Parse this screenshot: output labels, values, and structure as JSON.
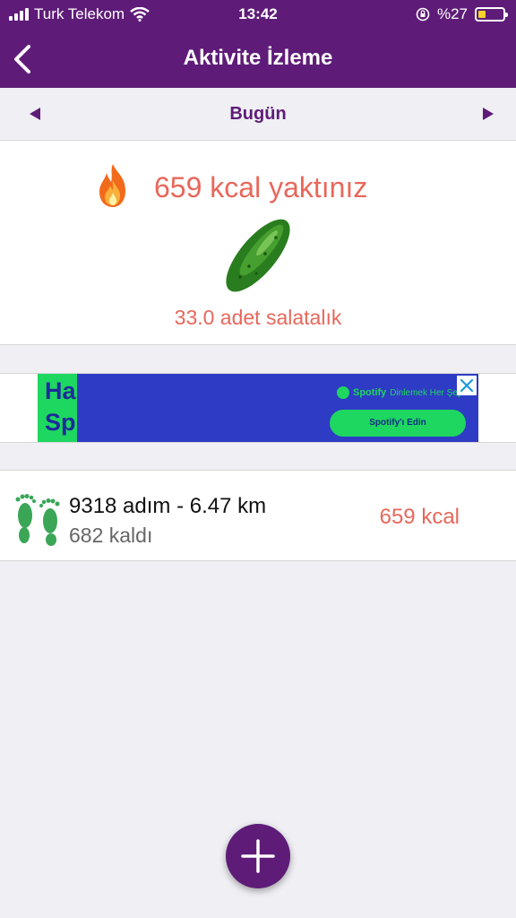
{
  "status_bar": {
    "carrier": "Turk Telekom",
    "time": "13:42",
    "battery_percent": "%27",
    "battery_color": "#f6d22b"
  },
  "nav": {
    "title": "Aktivite İzleme",
    "back_icon": "chevron-left-icon"
  },
  "day_selector": {
    "label": "Bugün",
    "prev_icon": "triangle-left-icon",
    "next_icon": "triangle-right-icon"
  },
  "burn_summary": {
    "kcal_text": "659 kcal yaktınız",
    "equivalent_text": "33.0 adet salatalık",
    "icons": [
      "fire-icon",
      "cucumber-icon"
    ]
  },
  "ad": {
    "left_text_line1": "Ha",
    "left_text_line2": "Sp",
    "brand": "Spotify",
    "tagline": "Dinlemek Her Şeyd",
    "cta_label": "Spotify'ı Edin"
  },
  "steps": {
    "main_text": "9318 adım - 6.47 km",
    "remaining_text": "682 kaldı",
    "kcal_text": "659 kcal",
    "icon": "footprints-icon"
  },
  "fab": {
    "icon": "plus-icon"
  },
  "colors": {
    "brand_purple": "#5e1c78",
    "accent_coral": "#e8675b",
    "spotify_green": "#1ed760",
    "ad_blue": "#2e3bc4",
    "background": "#efeff4"
  }
}
